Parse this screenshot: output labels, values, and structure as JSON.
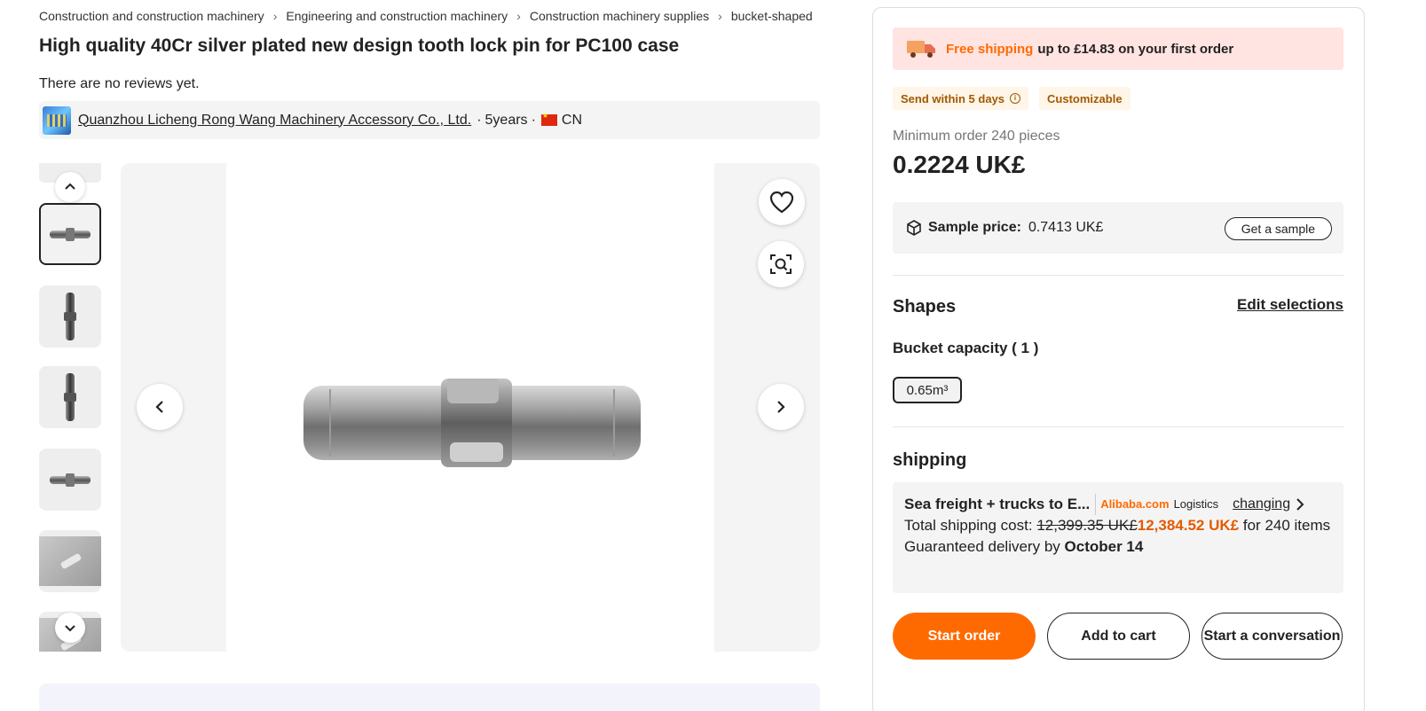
{
  "breadcrumb": [
    "Construction and construction machinery",
    "Engineering and construction machinery",
    "Construction machinery supplies",
    "bucket-shaped"
  ],
  "product": {
    "title": "High quality 40Cr silver plated new design tooth lock pin for PC100 case",
    "reviews_text": "There are no reviews yet."
  },
  "supplier": {
    "name": "Quanzhou Licheng Rong Wang Machinery Accessory Co., Ltd.",
    "years": "5years",
    "country": "CN"
  },
  "panel": {
    "promo_highlight": "Free shipping",
    "promo_rest": "up to £14.83 on your first order",
    "tags": [
      "Send within 5 days",
      "Customizable"
    ],
    "min_order": "Minimum order 240 pieces",
    "price": "0.2224 UK£",
    "sample_label": "Sample price:",
    "sample_value": "0.7413 UK£",
    "sample_button": "Get a sample",
    "shapes_heading": "Shapes",
    "edit_selections": "Edit selections",
    "bucket_heading": "Bucket capacity ( 1 )",
    "bucket_option": "0.65m³",
    "shipping_heading": "shipping",
    "shipping": {
      "method": "Sea freight + trucks to E...",
      "brand": "Alibaba.com",
      "brand_suffix": "Logistics",
      "changing": "changing",
      "cost_label": "Total shipping cost:",
      "old_cost": "12,399.35 UK£",
      "new_cost": "12,384.52 UK£",
      "for_text": "for",
      "items_text": "240 items",
      "delivery_label": "Guaranteed delivery by",
      "delivery_date": "October 14"
    },
    "buttons": {
      "start_order": "Start order",
      "add_to_cart": "Add to cart",
      "conversation": "Start a conversation"
    }
  },
  "colors": {
    "accent": "#ff6a00",
    "promo_bg": "#ffe4e1",
    "tag_bg": "#fff5e8"
  },
  "icons": [
    "chevron-right-icon",
    "chevron-up-icon",
    "chevron-down-icon",
    "chevron-left-icon",
    "heart-icon",
    "visual-search-icon",
    "truck-icon",
    "info-icon",
    "box-icon"
  ]
}
